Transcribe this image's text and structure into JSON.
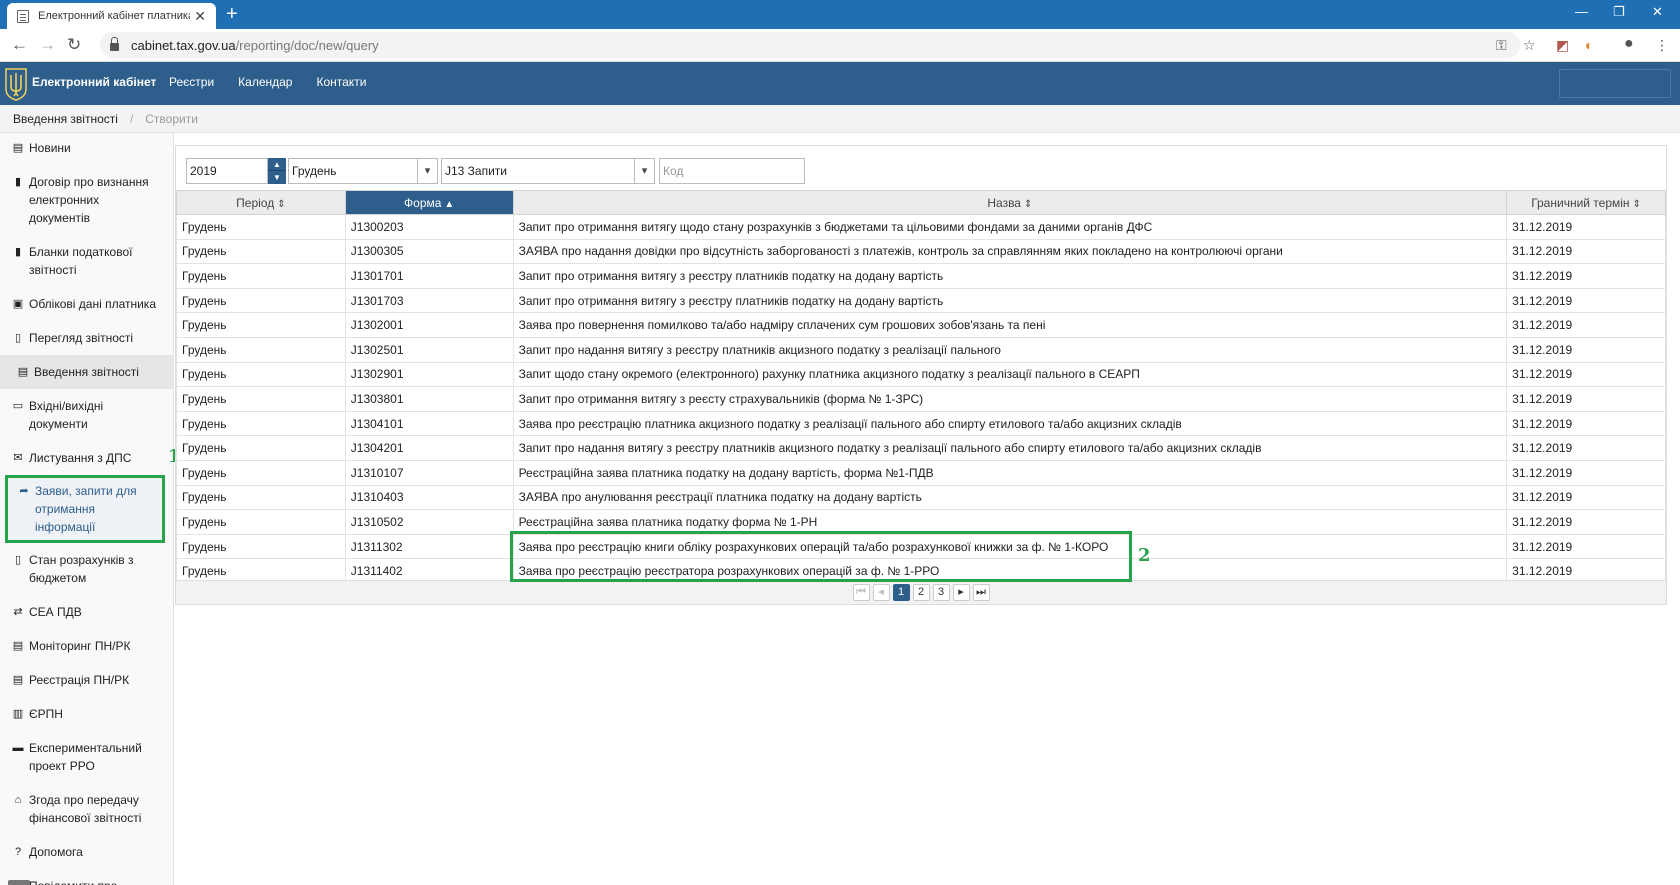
{
  "browser": {
    "tab_title": "Електронний кабінет платника",
    "url_host": "cabinet.tax.gov.ua",
    "url_path": "/reporting/doc/new/query"
  },
  "header": {
    "brand": "Електронний кабінет",
    "nav": [
      "Реєстри",
      "Календар",
      "Контакти"
    ]
  },
  "breadcrumb": {
    "parent": "Введення звітності",
    "current": "Створити"
  },
  "sidebar": {
    "items": [
      {
        "label": "Новини",
        "icon": "newspaper-icon"
      },
      {
        "label": "Договір про визнання електронних документів",
        "icon": "document-icon"
      },
      {
        "label": "Бланки податкової звітності",
        "icon": "book-icon"
      },
      {
        "label": "Облікові дані платника",
        "icon": "id-card-icon"
      },
      {
        "label": "Перегляд звітності",
        "icon": "file-icon"
      },
      {
        "label": "Введення звітності",
        "icon": "list-icon"
      },
      {
        "label": "Вхідні/вихідні документи",
        "icon": "inbox-icon"
      },
      {
        "label": "Листування з ДПС",
        "icon": "envelope-icon"
      },
      {
        "label": "Заяви, запити для отримання інформації",
        "icon": "share-icon"
      },
      {
        "label": "Стан розрахунків з бюджетом",
        "icon": "file-icon"
      },
      {
        "label": "СЕА ПДВ",
        "icon": "exchange-icon"
      },
      {
        "label": "Моніторинг ПН/РК",
        "icon": "list-icon"
      },
      {
        "label": "Реєстрація ПН/РК",
        "icon": "list-icon"
      },
      {
        "label": "ЄРПН",
        "icon": "barcode-icon"
      },
      {
        "label": "Експериментальний проект РРО",
        "icon": "print-icon"
      },
      {
        "label": "Згода про передачу фінансової звітності",
        "icon": "bank-icon"
      },
      {
        "label": "Допомога",
        "icon": "question-icon"
      },
      {
        "label": "Повідомити про помилку",
        "icon": "exclamation-icon"
      }
    ],
    "active_index": 5,
    "highlight_index": 8,
    "highlight_mark": "1"
  },
  "filters": {
    "year": "2019",
    "month": "Грудень",
    "group": "J13 Запити",
    "code_placeholder": "Код"
  },
  "table": {
    "columns": [
      "Період",
      "Форма",
      "Назва",
      "Граничний термін"
    ],
    "sorted_column": 1,
    "rows": [
      [
        "Грудень",
        "J1300203",
        "Запит про отримання витягу щодо стану розрахунків з бюджетами та цільовими фондами за даними органів ДФС",
        "31.12.2019"
      ],
      [
        "Грудень",
        "J1300305",
        "ЗАЯВА про надання довідки про відсутність заборгованості з платежів, контроль за справлянням яких покладено на контролюючі органи",
        "31.12.2019"
      ],
      [
        "Грудень",
        "J1301701",
        "Запит про отримання витягу з реєстру платників податку на додану вартість",
        "31.12.2019"
      ],
      [
        "Грудень",
        "J1301703",
        "Запит про отримання витягу з реєстру платників податку на додану вартість",
        "31.12.2019"
      ],
      [
        "Грудень",
        "J1302001",
        "Заява про повернення помилково та/або надміру сплачених сум грошових зобов'язань та пені",
        "31.12.2019"
      ],
      [
        "Грудень",
        "J1302501",
        "Запит про надання витягу з реєстру платників акцизного податку з реалізації пального",
        "31.12.2019"
      ],
      [
        "Грудень",
        "J1302901",
        "Запит щодо стану окремого (електронного) рахунку платника акцизного податку з реалізації пального в СЕАРП",
        "31.12.2019"
      ],
      [
        "Грудень",
        "J1303801",
        "Запит про отримання витягу з реєсту страхувальників (форма № 1-ЗРС)",
        "31.12.2019"
      ],
      [
        "Грудень",
        "J1304101",
        "Заява про реєстрацію платника акцизного податку з реалізації пального або спирту етилового та/або акцизних складів",
        "31.12.2019"
      ],
      [
        "Грудень",
        "J1304201",
        "Запит про надання витягу з реєстру платників акцизного податку з реалізації пального або спирту етилового та/або акцизних складів",
        "31.12.2019"
      ],
      [
        "Грудень",
        "J1310107",
        "Реєстраційна заява платника податку на додану вартість, форма №1-ПДВ",
        "31.12.2019"
      ],
      [
        "Грудень",
        "J1310403",
        "ЗАЯВА про анулювання реєстрації платника податку на додану вартість",
        "31.12.2019"
      ],
      [
        "Грудень",
        "J1310502",
        "Реєстраційна заява платника податку форма № 1-РН",
        "31.12.2019"
      ],
      [
        "Грудень",
        "J1311302",
        "Заява про реєстрацію книги обліку розрахункових операцій та/або розрахункової книжки за ф. № 1-КОРО",
        "31.12.2019"
      ],
      [
        "Грудень",
        "J1311402",
        "Заява про реєстрацію реєстратора розрахункових операцій за ф. № 1-РРО",
        "31.12.2019"
      ]
    ],
    "highlight_mark": "2"
  },
  "pagination": {
    "pages": [
      "1",
      "2",
      "3"
    ],
    "current": "1"
  },
  "colors": {
    "header": "#2e5e8c",
    "chrome": "#1f6fb5",
    "highlight": "#27a34b"
  }
}
